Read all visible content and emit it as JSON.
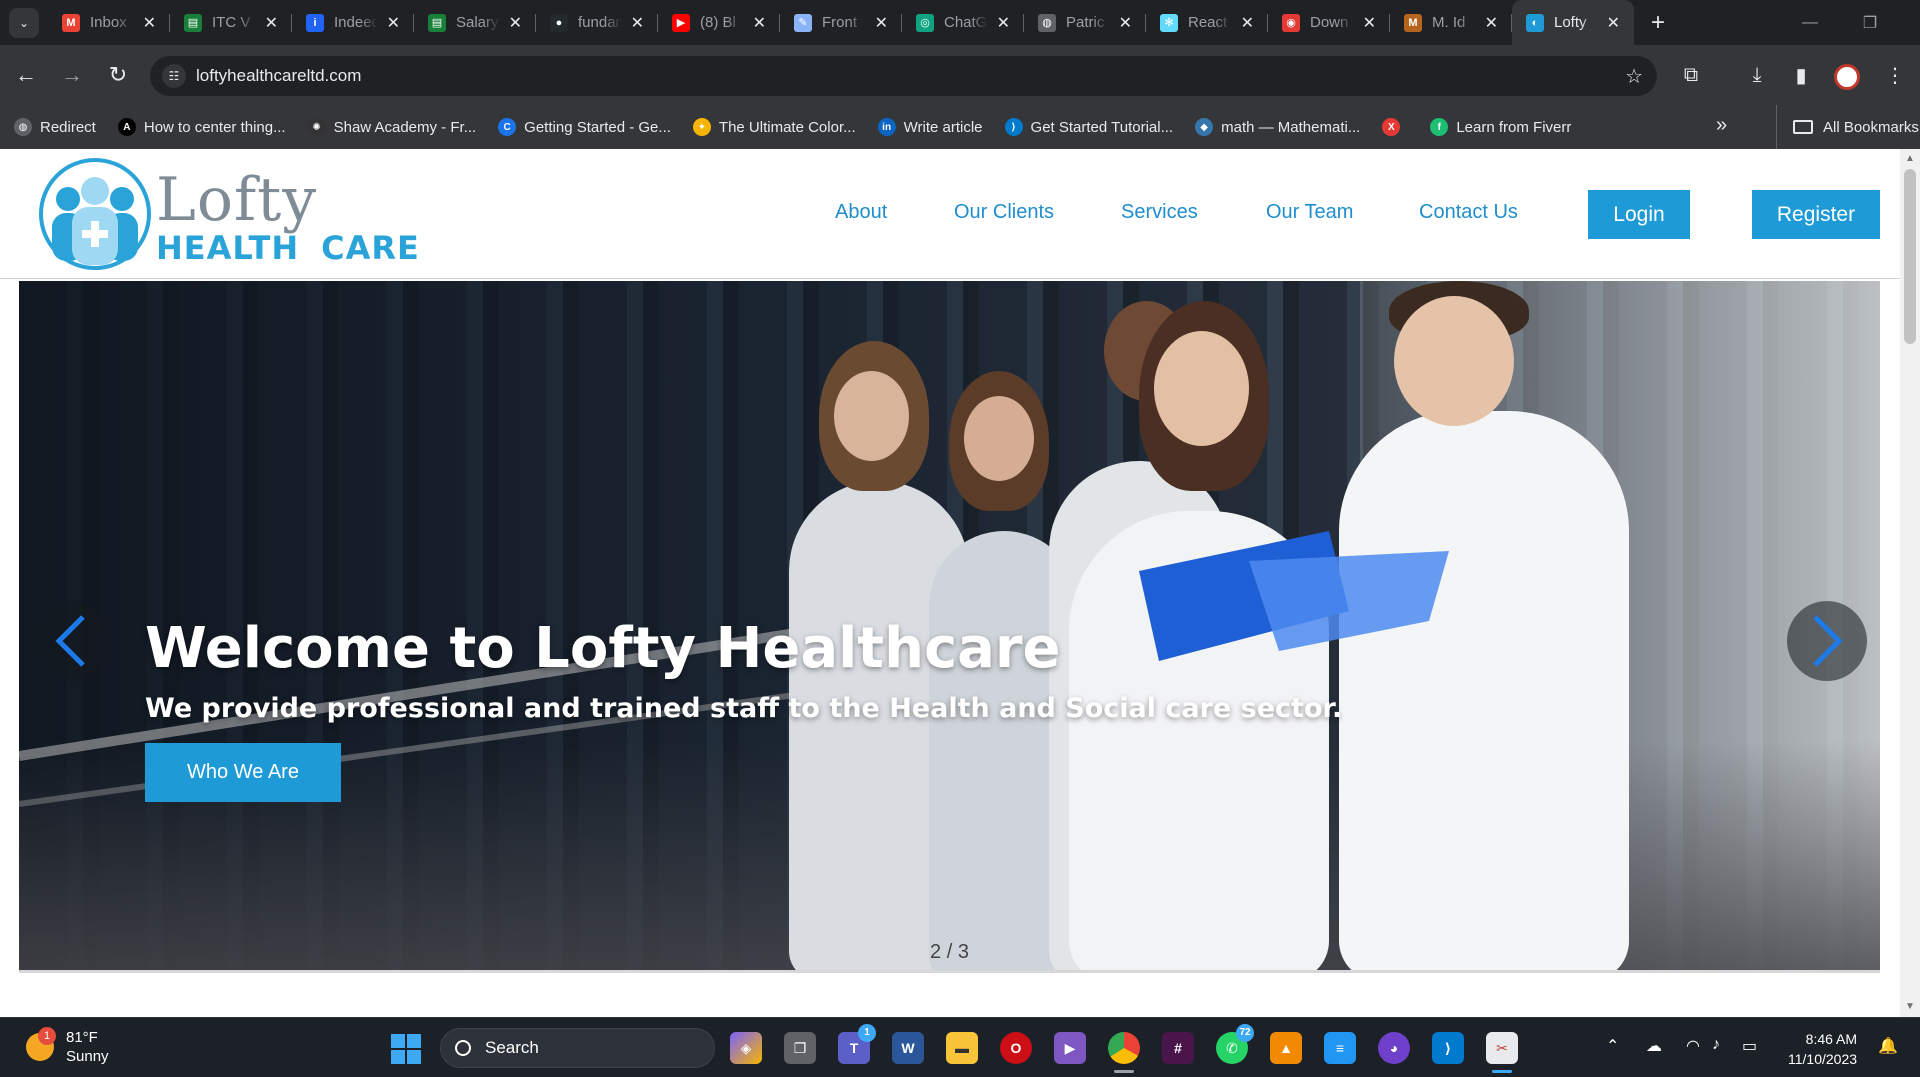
{
  "browser": {
    "tabs": [
      {
        "title": "Inbox",
        "icon": "gmail-icon",
        "color": "#ea4335",
        "glyph": "M"
      },
      {
        "title": "ITC V",
        "icon": "sheet-icon",
        "color": "#188038",
        "glyph": "▤"
      },
      {
        "title": "Indeed",
        "icon": "indeed-icon",
        "color": "#2164f3",
        "glyph": "i"
      },
      {
        "title": "Salary",
        "icon": "sheet-icon",
        "color": "#188038",
        "glyph": "▤"
      },
      {
        "title": "fundamentals",
        "icon": "github-icon",
        "color": "#24292e",
        "glyph": "●"
      },
      {
        "title": "(8) Bl",
        "icon": "youtube-icon",
        "color": "#ff0000",
        "glyph": "▶"
      },
      {
        "title": "Front",
        "icon": "doc-icon",
        "color": "#8ab4f8",
        "glyph": "✎"
      },
      {
        "title": "ChatGPT",
        "icon": "chatgpt-icon",
        "color": "#10a37f",
        "glyph": "◎"
      },
      {
        "title": "Patric",
        "icon": "globe-icon",
        "color": "#5f6368",
        "glyph": "◍"
      },
      {
        "title": "React",
        "icon": "react-icon",
        "color": "#61dafb",
        "glyph": "✻"
      },
      {
        "title": "Down",
        "icon": "download-site-icon",
        "color": "#e53935",
        "glyph": "◉"
      },
      {
        "title": "M. Id",
        "icon": "medium-icon",
        "color": "#b5651d",
        "glyph": "M"
      },
      {
        "title": "Lofty",
        "icon": "lofty-icon",
        "color": "#1e9ad6",
        "glyph": "◐",
        "active": true
      }
    ],
    "url": "loftyhealthcareltd.com",
    "bookmarks": [
      {
        "label": "Redirect",
        "icon": "globe-icon",
        "color": "#5f6368",
        "glyph": "◍"
      },
      {
        "label": "How to center thing...",
        "icon": "article-icon",
        "color": "#000000",
        "glyph": "A"
      },
      {
        "label": "Shaw Academy - Fr...",
        "icon": "shaw-icon",
        "color": "#333333",
        "glyph": "✺"
      },
      {
        "label": "Getting Started - Ge...",
        "icon": "c-icon",
        "color": "#1a73e8",
        "glyph": "C"
      },
      {
        "label": "The Ultimate Color...",
        "icon": "bulb-icon",
        "color": "#f4b400",
        "glyph": "✦"
      },
      {
        "label": "Write article",
        "icon": "linkedin-icon",
        "color": "#0a66c2",
        "glyph": "in"
      },
      {
        "label": "Get Started Tutorial...",
        "icon": "vscode-icon",
        "color": "#007acc",
        "glyph": "⟩"
      },
      {
        "label": "math — Mathemati...",
        "icon": "python-icon",
        "color": "#3776ab",
        "glyph": "◆"
      },
      {
        "label": "",
        "icon": "x-site-icon",
        "color": "#e53935",
        "glyph": "X"
      },
      {
        "label": "Learn from Fiverr",
        "icon": "fiverr-icon",
        "color": "#1dbf73",
        "glyph": "f"
      }
    ],
    "all_bookmarks": "All Bookmarks"
  },
  "site": {
    "logo": {
      "line1": "Lofty",
      "line2a": "HEALTH",
      "line2b": "CARE"
    },
    "nav": [
      "About",
      "Our Clients",
      "Services",
      "Our Team",
      "Contact Us"
    ],
    "login": "Login",
    "register": "Register",
    "hero": {
      "title": "Welcome to Lofty Healthcare",
      "subtitle": "We provide professional and trained staff to the Health and Social care sector.",
      "cta": "Who We Are",
      "counter": "2 / 3"
    }
  },
  "taskbar": {
    "weather_badge": "1",
    "temperature": "81°F",
    "condition": "Sunny",
    "search": "Search",
    "teams_badge": "1",
    "whatsapp_badge": "72",
    "time": "8:46 AM",
    "date": "11/10/2023"
  },
  "colors": {
    "accent": "#1e9ad6",
    "nav_link": "#1f8ecd",
    "logo_grey": "#7f8c95"
  }
}
